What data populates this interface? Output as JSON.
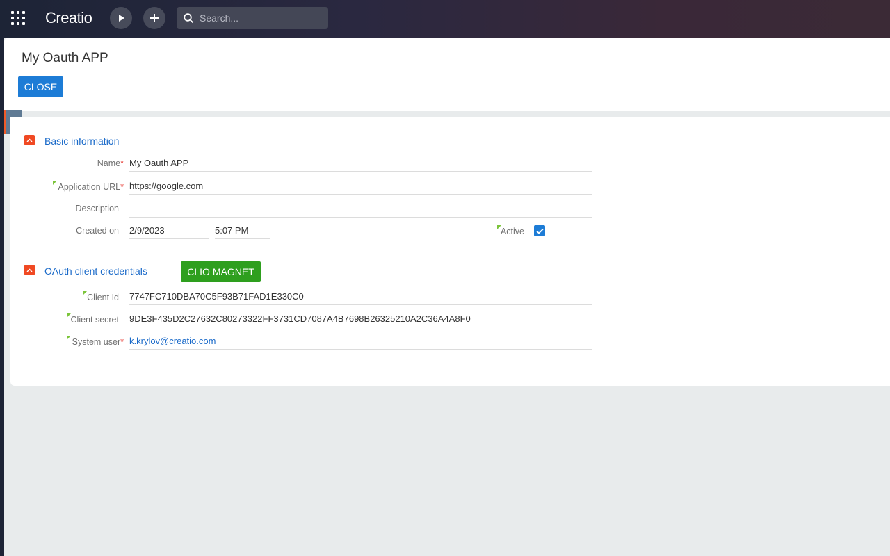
{
  "topbar": {
    "logo": "Creatio",
    "search_placeholder": "Search..."
  },
  "page": {
    "title": "My Oauth APP",
    "close_label": "CLOSE"
  },
  "basic_info": {
    "title": "Basic information",
    "name_label": "Name",
    "name_value": "My Oauth APP",
    "app_url_label": "Application URL",
    "app_url_value": "https://google.com",
    "description_label": "Description",
    "description_value": "",
    "created_on_label": "Created on",
    "created_date": "2/9/2023",
    "created_time": "5:07 PM",
    "active_label": "Active",
    "active": true
  },
  "credentials": {
    "title": "OAuth client credentials",
    "action_label": "CLIO MAGNET",
    "client_id_label": "Client Id",
    "client_id_value": "7747FC710DBA70C5F93B71FAD1E330C0",
    "client_secret_label": "Client secret",
    "client_secret_value": "9DE3F435D2C27632C80273322FF3731CD7087A4B7698B26325210A2C36A4A8F0",
    "system_user_label": "System user",
    "system_user_value": "k.krylov@creatio.com"
  },
  "colors": {
    "accent": "#1d7cd6",
    "section_toggle": "#f04923",
    "action_green": "#2e9f1e",
    "link": "#1a6ac9"
  }
}
